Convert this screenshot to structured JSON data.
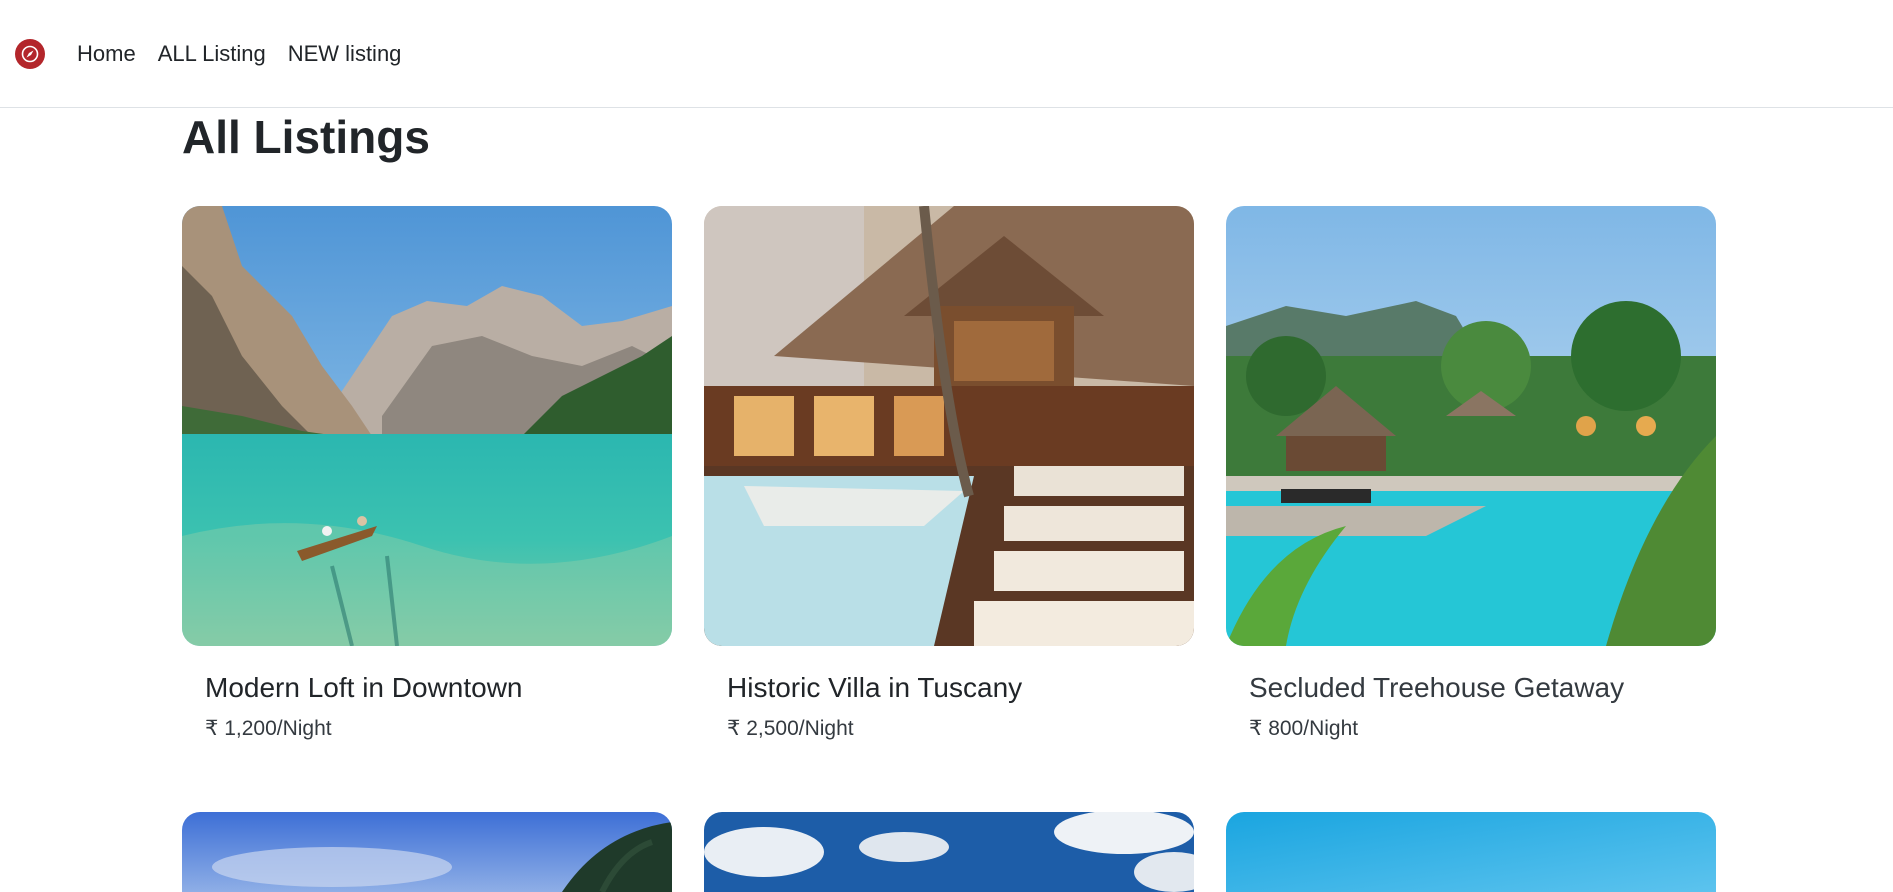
{
  "nav": {
    "brand_icon": "compass-icon",
    "brand_color": "#b3262b",
    "links": [
      "Home",
      "ALL Listing",
      "NEW listing"
    ]
  },
  "page": {
    "title": "All Listings"
  },
  "listings": [
    {
      "title": "Modern Loft in Downtown",
      "price": "₹ 1,200/Night",
      "image": "mountain-lake-boat"
    },
    {
      "title": "Historic Villa in Tuscany",
      "price": "₹ 2,500/Night",
      "image": "resort-pool-deck"
    },
    {
      "title": "Secluded Treehouse Getaway",
      "price": "₹ 800/Night",
      "image": "tropical-pool-huts"
    }
  ],
  "partial_listings": [
    {
      "image": "beach-palm-sky"
    },
    {
      "image": "cloudy-sky"
    },
    {
      "image": "blue-sky"
    }
  ]
}
